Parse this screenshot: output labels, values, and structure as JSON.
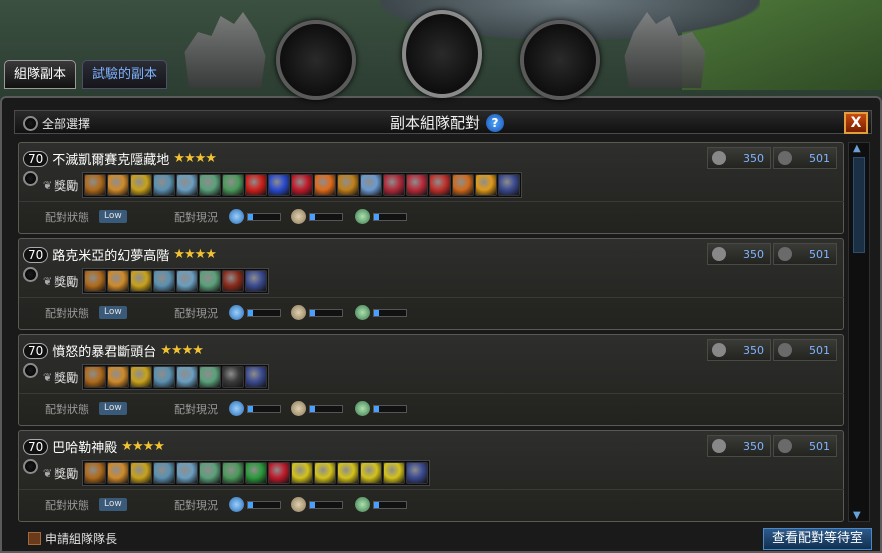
{
  "tabs": [
    {
      "label": "組隊副本",
      "active": true
    },
    {
      "label": "試驗的副本",
      "active": false
    }
  ],
  "header": {
    "select_all_label": "全部選擇",
    "title": "副本組隊配對",
    "help_label": "?",
    "close_label": "X"
  },
  "common": {
    "reward_label": "獎勵",
    "status_label": "配對狀態",
    "status_value": "Low",
    "match_label": "配對現況"
  },
  "dungeons": [
    {
      "level": "70",
      "name": "不滅凱爾賽克隱藏地",
      "stars": "★★★★",
      "score_a": "350",
      "score_b": "501",
      "reward_colors": [
        "#b06a1a",
        "#d08a2a",
        "#c9a21a",
        "#5a90b0",
        "#6a9ec0",
        "#5aa07a",
        "#4a9a5a",
        "#d0201a",
        "#2a4ad0",
        "#c01a2a",
        "#e06a1a",
        "#c0801a",
        "#6a9ad0",
        "#b02a3a",
        "#b82a3a",
        "#c0302a",
        "#d06a1a",
        "#e09a1a",
        "#3a4a90"
      ]
    },
    {
      "level": "70",
      "name": "路克米亞的幻夢高階",
      "stars": "★★★★",
      "score_a": "350",
      "score_b": "501",
      "reward_colors": [
        "#b06a1a",
        "#d08a2a",
        "#c9a21a",
        "#5a90b0",
        "#6a9ec0",
        "#5aa07a",
        "#8a2a1a",
        "#3a4a90"
      ]
    },
    {
      "level": "70",
      "name": "憤怒的暴君斷頭台",
      "stars": "★★★★",
      "score_a": "350",
      "score_b": "501",
      "reward_colors": [
        "#b06a1a",
        "#d08a2a",
        "#c9a21a",
        "#5a90b0",
        "#6a9ec0",
        "#5aa07a",
        "#3a3a3a",
        "#3a4a90"
      ]
    },
    {
      "level": "70",
      "name": "巴哈勒神殿",
      "stars": "★★★★",
      "score_a": "350",
      "score_b": "501",
      "reward_colors": [
        "#b06a1a",
        "#d08a2a",
        "#c9a21a",
        "#5a90b0",
        "#6a9ec0",
        "#5aa07a",
        "#4a9a5a",
        "#2a9a3a",
        "#c01a2a",
        "#d4c21a",
        "#d4c21a",
        "#d4c21a",
        "#d4c21a",
        "#d4c21a",
        "#3a4a90"
      ]
    }
  ],
  "footer": {
    "leader_label": "申請組隊隊長",
    "wait_button_label": "查看配對等待室"
  }
}
